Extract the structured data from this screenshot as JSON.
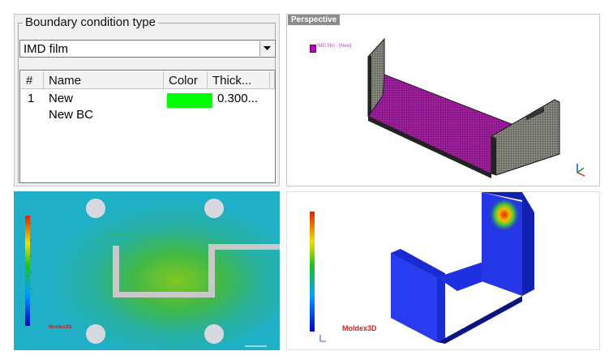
{
  "boundary_panel": {
    "legend": "Boundary condition type",
    "select_value": "IMD film",
    "columns": [
      "#",
      "Name",
      "Color",
      "Thick..."
    ],
    "rows": [
      {
        "index": "1",
        "name": "New",
        "name2": "New BC",
        "color": "#00ff00",
        "thickness": "0.300..."
      }
    ]
  },
  "perspective": {
    "label": "Perspective",
    "legend_text": "IMD film : [New]",
    "part_color": "#a020a0"
  },
  "result_right": {
    "brand": "Moldex3D"
  },
  "result_left": {
    "brand": "Moldex3D"
  },
  "colors": {
    "accent_green": "#00ff00",
    "magenta": "#a020a0",
    "result_blue": "#1a2bd0"
  }
}
